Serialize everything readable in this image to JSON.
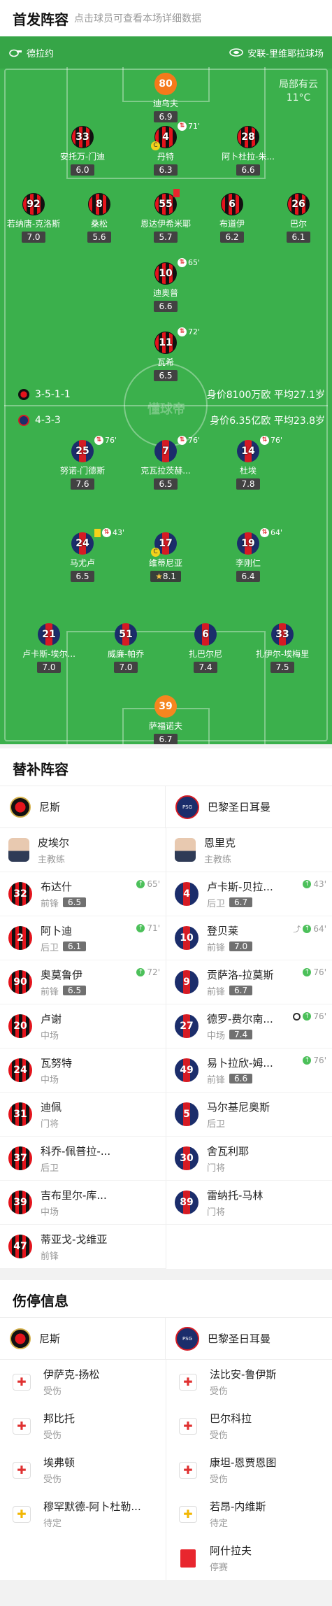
{
  "header": {
    "title": "首发阵容",
    "subtitle": "点击球员可查看本场详细数据"
  },
  "venue": {
    "referee": "德拉约",
    "stadium": "安联-里维耶拉球场"
  },
  "weather": {
    "desc": "局部有云",
    "temp": "11°C"
  },
  "watermark": "懂球帝",
  "home_form": {
    "formation": "3-5-1-1",
    "info": "身价8100万欧 平均27.1岁"
  },
  "away_form": {
    "formation": "4-3-3",
    "info": "身价6.35亿欧 平均23.8岁"
  },
  "home_players": [
    {
      "num": "80",
      "name": "迪乌夫",
      "rating": "6.9"
    },
    {
      "num": "33",
      "name": "安托万-门迪",
      "rating": "6.0"
    },
    {
      "num": "4",
      "name": "丹特",
      "rating": "6.3",
      "sub": "71'"
    },
    {
      "num": "28",
      "name": "阿卜杜拉-朱...",
      "rating": "6.6"
    },
    {
      "num": "92",
      "name": "若纳唐-克洛斯",
      "rating": "7.0"
    },
    {
      "num": "8",
      "name": "桑松",
      "rating": "5.6"
    },
    {
      "num": "55",
      "name": "恩达伊希米耶",
      "rating": "5.7"
    },
    {
      "num": "6",
      "name": "布道伊",
      "rating": "6.2"
    },
    {
      "num": "26",
      "name": "巴尔",
      "rating": "6.1"
    },
    {
      "num": "10",
      "name": "迪奥普",
      "rating": "6.6",
      "sub": "65'"
    },
    {
      "num": "11",
      "name": "瓦希",
      "rating": "6.5",
      "sub": "72'"
    }
  ],
  "away_players": [
    {
      "num": "25",
      "name": "努诺-门德斯",
      "rating": "7.6",
      "sub": "76'"
    },
    {
      "num": "7",
      "name": "克瓦拉茨赫...",
      "rating": "6.5",
      "sub": "76'"
    },
    {
      "num": "14",
      "name": "杜埃",
      "rating": "7.8",
      "sub": "76'"
    },
    {
      "num": "24",
      "name": "马尤卢",
      "rating": "6.5",
      "sub": "43'"
    },
    {
      "num": "17",
      "name": "维蒂尼亚",
      "rating": "8.1"
    },
    {
      "num": "19",
      "name": "李刚仁",
      "rating": "6.4",
      "sub": "64'"
    },
    {
      "num": "21",
      "name": "卢卡斯-埃尔...",
      "rating": "7.0"
    },
    {
      "num": "51",
      "name": "威廉-帕乔",
      "rating": "7.0"
    },
    {
      "num": "6",
      "name": "扎巴尔尼",
      "rating": "7.4"
    },
    {
      "num": "33",
      "name": "扎伊尔-埃梅里",
      "rating": "7.5"
    },
    {
      "num": "39",
      "name": "萨福诺夫",
      "rating": "6.7"
    }
  ],
  "subs_title": "替补阵容",
  "teams": {
    "home": "尼斯",
    "away": "巴黎圣日耳曼"
  },
  "psg_crest_text": "PSG",
  "coaches": {
    "home": {
      "name": "皮埃尔",
      "role": "主教练"
    },
    "away": {
      "name": "恩里克",
      "role": "主教练"
    }
  },
  "subs": [
    {
      "num": "32",
      "team": "n",
      "name": "布达什",
      "pos": "前锋",
      "rating": "6.5",
      "min": "65'"
    },
    {
      "num": "4",
      "team": "p",
      "name": "卢卡斯-贝拉...",
      "pos": "后卫",
      "rating": "6.7",
      "min": "43'"
    },
    {
      "num": "2",
      "team": "n",
      "name": "阿卜迪",
      "pos": "后卫",
      "rating": "6.1",
      "min": "71'"
    },
    {
      "num": "10",
      "team": "p",
      "name": "登贝莱",
      "pos": "前锋",
      "rating": "7.0",
      "min": "64'",
      "assist": true
    },
    {
      "num": "90",
      "team": "n",
      "name": "奥莫鲁伊",
      "pos": "前锋",
      "rating": "6.5",
      "min": "72'"
    },
    {
      "num": "9",
      "team": "p",
      "name": "贡萨洛-拉莫斯",
      "pos": "前锋",
      "rating": "6.7",
      "min": "76'"
    },
    {
      "num": "20",
      "team": "n",
      "name": "卢谢",
      "pos": "中场"
    },
    {
      "num": "27",
      "team": "p",
      "name": "德罗-费尔南...",
      "pos": "中场",
      "rating": "7.4",
      "min": "76'",
      "goal": true
    },
    {
      "num": "24",
      "team": "n",
      "name": "瓦努特",
      "pos": "中场"
    },
    {
      "num": "49",
      "team": "p",
      "name": "易卜拉欣-姆...",
      "pos": "前锋",
      "rating": "6.6",
      "min": "76'"
    },
    {
      "num": "31",
      "team": "n",
      "name": "迪佩",
      "pos": "门将"
    },
    {
      "num": "5",
      "team": "p",
      "name": "马尔基尼奥斯",
      "pos": "后卫"
    },
    {
      "num": "37",
      "team": "n",
      "name": "科乔-佩普拉-...",
      "pos": "后卫"
    },
    {
      "num": "30",
      "team": "p",
      "name": "舍瓦利耶",
      "pos": "门将"
    },
    {
      "num": "39",
      "team": "n",
      "name": "吉布里尔-库...",
      "pos": "中场"
    },
    {
      "num": "89",
      "team": "p",
      "name": "雷纳托-马林",
      "pos": "门将"
    },
    {
      "num": "47",
      "team": "n",
      "name": "蒂亚戈-戈维亚",
      "pos": "前锋"
    }
  ],
  "inj_title": "伤停信息",
  "injuries": [
    {
      "name": "伊萨克-扬松",
      "status": "受伤",
      "type": "red"
    },
    {
      "name": "法比安-鲁伊斯",
      "status": "受伤",
      "type": "red"
    },
    {
      "name": "邦比托",
      "status": "受伤",
      "type": "red"
    },
    {
      "name": "巴尔科拉",
      "status": "受伤",
      "type": "red"
    },
    {
      "name": "埃弗顿",
      "status": "受伤",
      "type": "red"
    },
    {
      "name": "康坦-恩贾恩图",
      "status": "受伤",
      "type": "red"
    },
    {
      "name": "穆罕默德-阿卜杜勒...",
      "status": "待定",
      "type": "yellow"
    },
    {
      "name": "若昂-内维斯",
      "status": "待定",
      "type": "yellow"
    },
    {
      "name": "",
      "status": "",
      "type": "blank"
    },
    {
      "name": "阿什拉夫",
      "status": "停赛",
      "type": "card"
    }
  ]
}
